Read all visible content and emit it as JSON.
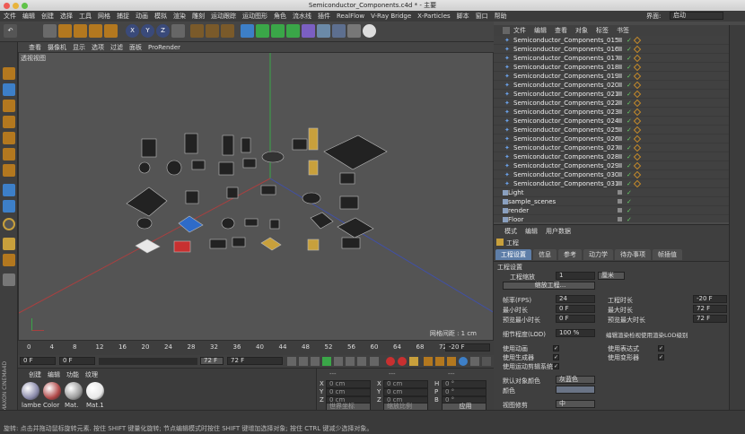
{
  "window": {
    "title": "Semiconductor_Components.c4d * - 主要"
  },
  "menubar": {
    "items": [
      "文件",
      "编辑",
      "创建",
      "选择",
      "工具",
      "网格",
      "捕捉",
      "动画",
      "模拟",
      "渲染",
      "雕刻",
      "运动跟踪",
      "运动图形",
      "角色",
      "流水线",
      "插件",
      "RealFlow",
      "V-Ray Bridge",
      "X-Particles",
      "脚本",
      "窗口",
      "帮助"
    ],
    "layout_label": "界面:",
    "layout_value": "启动"
  },
  "viewport": {
    "menu": [
      "查看",
      "摄像机",
      "显示",
      "选项",
      "过滤",
      "面板",
      "ProRender"
    ],
    "label": "透视视图",
    "grid_spacing": "网格间距 : 1 cm"
  },
  "timeline": {
    "ticks": [
      "0",
      "4",
      "8",
      "12",
      "16",
      "20",
      "24",
      "28",
      "32",
      "36",
      "40",
      "44",
      "48",
      "52",
      "56",
      "60",
      "64",
      "68",
      "72"
    ],
    "end_frame": "-20 F"
  },
  "transport": {
    "current": "0 F",
    "start": "0 F",
    "preview_end": "72 F",
    "end": "72 F"
  },
  "material_manager": {
    "menu": [
      "创建",
      "编辑",
      "功能",
      "纹理"
    ],
    "materials": [
      {
        "name": "lambe",
        "color": "#8a8aaa"
      },
      {
        "name": "Color",
        "color": "#b04848"
      },
      {
        "name": "Mat.",
        "color": "#9a9a9a"
      },
      {
        "name": "Mat.1",
        "color": "#e8e8e8"
      }
    ],
    "brand": "MAXON CINEMA4D"
  },
  "coords": {
    "header": [
      "---",
      "---",
      "---"
    ],
    "rows": [
      {
        "a": "X",
        "v1": "0 cm",
        "b": "X",
        "v2": "0 cm",
        "c": "H",
        "v3": "0 °"
      },
      {
        "a": "Y",
        "v1": "0 cm",
        "b": "Y",
        "v2": "0 cm",
        "c": "P",
        "v3": "0 °"
      },
      {
        "a": "Z",
        "v1": "0 cm",
        "b": "Z",
        "v2": "0 cm",
        "c": "B",
        "v3": "0 °"
      }
    ],
    "mode1": "世界坐标",
    "mode2": "缩放比例",
    "apply": "应用"
  },
  "object_manager": {
    "menu": [
      "文件",
      "编辑",
      "查看",
      "对象",
      "标签",
      "书签"
    ],
    "objects": [
      "Semiconductor_Components_015",
      "Semiconductor_Components_016",
      "Semiconductor_Components_017",
      "Semiconductor_Components_018",
      "Semiconductor_Components_019",
      "Semiconductor_Components_020",
      "Semiconductor_Components_021",
      "Semiconductor_Components_022",
      "Semiconductor_Components_023",
      "Semiconductor_Components_024",
      "Semiconductor_Components_025",
      "Semiconductor_Components_026",
      "Semiconductor_Components_027",
      "Semiconductor_Components_028",
      "Semiconductor_Components_029",
      "Semiconductor_Components_030",
      "Semiconductor_Components_031"
    ],
    "extras": [
      "Light",
      "sample_scenes",
      "render",
      "Floor"
    ]
  },
  "attributes": {
    "menu": [
      "模式",
      "编辑",
      "用户数据"
    ],
    "title": "工程",
    "tabs": [
      "工程设置",
      "信息",
      "参考",
      "动力学",
      "待办事项",
      "帧插值"
    ],
    "section": "工程设置",
    "scale_label": "工程缩放",
    "scale_value": "1",
    "scale_unit": "厘米",
    "scale_button": "缩放工程...",
    "fps_label": "帧率(FPS)",
    "fps": "24",
    "duration_label": "工程时长",
    "duration": "-20 F",
    "min_label": "最小时长",
    "min": "0 F",
    "max_label": "最大时长",
    "max": "72 F",
    "pmin_label": "预览最小时长",
    "pmin": "0 F",
    "pmax_label": "预览最大时长",
    "pmax": "72 F",
    "lod_label": "细节程度(LOD)",
    "lod": "100 %",
    "lod_note": "编辑渲染检视使用渲染LOD级别",
    "checks": [
      "使用动画",
      "使用表达式",
      "使用生成器",
      "使用变形器",
      "使用运动剪辑系统"
    ],
    "default_color_label": "默认对象颜色",
    "default_color": "灰蓝色",
    "color_label": "颜色",
    "view_label": "视图修剪",
    "view_value": "中",
    "linear_label": "线性工作流程",
    "input_label": "输入色彩特性",
    "input_value": "sRGB"
  },
  "status": {
    "text": "旋转: 点击并拖动鼠标旋转元素. 按住 SHIFT 键量化旋转; 节点编辑模式时按住 SHIFT 键增加选择对象; 按住 CTRL 键减少选择对象。"
  },
  "colors": {
    "accent": "#5e7ea8",
    "background": "#4a4a4a",
    "viewport": "#545454"
  }
}
